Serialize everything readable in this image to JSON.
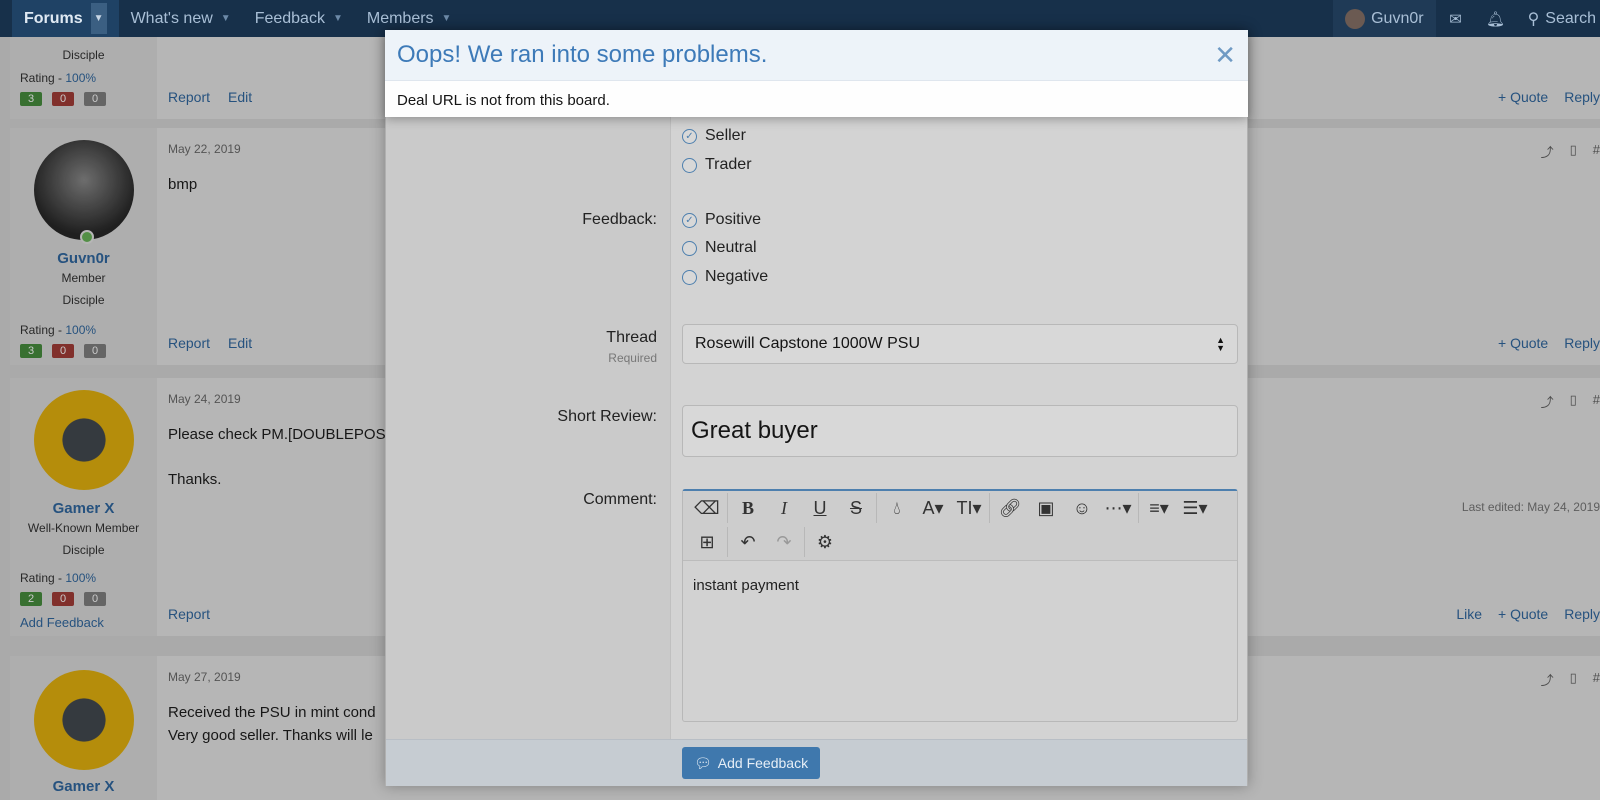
{
  "nav": {
    "tabs": [
      "Forums",
      "What's new",
      "Feedback",
      "Members"
    ],
    "user": "Guvn0r",
    "search_label": "Search"
  },
  "posts": [
    {
      "rank": "Disciple",
      "rating_label": "Rating -",
      "rating_pct": "100%",
      "pos": "3",
      "neu_red": "0",
      "neg": "0",
      "links": [
        "Report",
        "Edit"
      ],
      "actions": [
        "+ Quote",
        "Reply"
      ]
    },
    {
      "date": "May 22, 2019",
      "text": "bmp",
      "username": "Guvn0r",
      "title": "Member",
      "rank": "Disciple",
      "rating_label": "Rating -",
      "rating_pct": "100%",
      "pos": "3",
      "neu_red": "0",
      "neg": "0",
      "links": [
        "Report",
        "Edit"
      ],
      "actions": [
        "+ Quote",
        "Reply"
      ]
    },
    {
      "date": "May 24, 2019",
      "text1": "Please check PM.[DOUBLEPOST",
      "text2": "Thanks.",
      "username": "Gamer X",
      "title": "Well-Known Member",
      "rank": "Disciple",
      "rating_label": "Rating -",
      "rating_pct": "100%",
      "pos": "2",
      "neu_red": "0",
      "neg": "0",
      "add_feedback": "Add Feedback",
      "links": [
        "Report"
      ],
      "actions": [
        "Like",
        "+ Quote",
        "Reply"
      ],
      "edited": "Last edited: May 24, 2019"
    },
    {
      "date": "May 27, 2019",
      "text1": "Received the PSU in mint cond",
      "text2": "Very good seller. Thanks will le",
      "username": "Gamer X"
    }
  ],
  "modal": {
    "role_options": [
      "Seller",
      "Trader"
    ],
    "feedback_label": "Feedback:",
    "feedback_options": [
      "Positive",
      "Neutral",
      "Negative"
    ],
    "thread_label": "Thread",
    "thread_hint": "Required",
    "thread_value": "Rosewill Capstone 1000W PSU",
    "review_label": "Short Review:",
    "review_value": "Great buyer",
    "comment_label": "Comment:",
    "comment_value": "instant payment",
    "submit_label": "Add Feedback"
  },
  "error": {
    "title": "Oops! We ran into some problems.",
    "message": "Deal URL is not from this board."
  }
}
